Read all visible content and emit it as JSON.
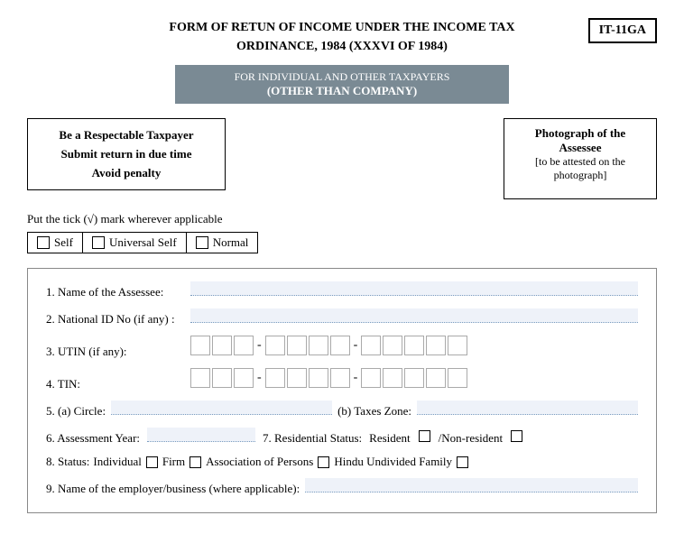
{
  "header": {
    "title_line1": "FORM OF RETUN OF INCOME UNDER THE INCOME TAX",
    "title_line2": "ORDINANCE, 1984 (XXXVI OF 1984)",
    "form_code": "IT-11GA"
  },
  "subtitle": {
    "line1": "FOR INDIVIDUAL AND OTHER TAXPAYERS",
    "line2": "(OTHER THAN COMPANY)"
  },
  "taxpayer_box": {
    "line1": "Be a Respectable Taxpayer",
    "line2": "Submit return in due time",
    "line3": "Avoid penalty"
  },
  "photo_box": {
    "title": "Photograph of the Assessee",
    "note": "[to be attested on the photograph]"
  },
  "tick_label": "Put the tick (√) mark wherever applicable",
  "tick_options": [
    {
      "label": "Self"
    },
    {
      "label": "Universal Self"
    },
    {
      "label": "Normal"
    }
  ],
  "form_fields": {
    "field1_label": "1.  Name of the Assessee:",
    "field2_label": "2.  National ID No (if any) :",
    "field3_label": "3. UTIN (if any):",
    "field4_label": "4. TIN:",
    "field5a_label": "5.  (a) Circle:",
    "field5b_label": "(b) Taxes Zone:",
    "field6_label": "6.  Assessment Year:",
    "field7_label": "7.  Residential Status:",
    "field7_resident": "Resident",
    "field7_nonresident": "/Non-resident",
    "field8_label": "8.  Status:",
    "field8_individual": "Individual",
    "field8_firm": "Firm",
    "field8_aop": "Association of Persons",
    "field8_huf": "Hindu Undivided Family",
    "field9_label": "9. Name of the employer/business (where applicable):"
  }
}
